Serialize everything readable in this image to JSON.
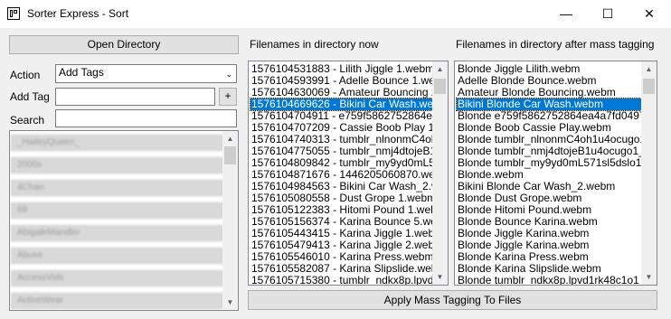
{
  "window": {
    "title": "Sorter Express - Sort",
    "minimize": "—",
    "maximize": "☐",
    "close": "✕"
  },
  "left": {
    "open_directory": "Open Directory",
    "action_label": "Action",
    "action_value": "Add Tags",
    "add_tag_label": "Add Tag",
    "add_tag_value": "",
    "add_button": "+",
    "search_label": "Search",
    "search_value": "",
    "tags": [
      "_HaileyQueen_",
      "2000s",
      "4Chan",
      "69",
      "AbigaleMandler",
      "Abuse",
      "AccessVids",
      "ActiveWear"
    ],
    "tag_scroll_thumb": 0.1
  },
  "middle": {
    "header": "Filenames in directory now",
    "files": [
      "1576104531883 - Lilith Jiggle 1.webm",
      "1576104593991 - Adelle Bounce 1.webm",
      "1576104630069 - Amateur Bouncing 2.webm",
      "1576104669626 - Bikini Car Wash.webm",
      "1576104704911 - e759f5862752864ea4a7",
      "1576104707209 - Cassie Boob Play 1.web",
      "1576104740313 - tumblr_nlnonmC4oh1u4c",
      "1576104775055 - tumblr_nmj4dtojeB1u4c",
      "1576104809842 - tumblr_my9yd0mL571sl",
      "1576104871676 - 1446205060870.webm",
      "1576104984563 - Bikini Car Wash_2.webm",
      "1576105080558 - Dust Grope 1.webm",
      "1576105122383 - Hitomi Pound 1.webm",
      "1576105156374 - Karina Bounce 5.webm",
      "1576105443415 - Karina Jiggle 1.webm",
      "1576105479413 - Karina Jiggle 2.webm",
      "1576105546010 - Karina Press.webm",
      "1576105582087 - Karina Slipslide.webm",
      "1576105715380 - tumblr_ndkx8p.lpvd1rk4"
    ],
    "selected_index": 3,
    "scroll_thumb": 0.08
  },
  "right": {
    "header": "Filenames in directory after mass tagging",
    "files": [
      "Blonde Jiggle Lilith.webm",
      "Adelle Blonde Bounce.webm",
      "Amateur Blonde Bouncing.webm",
      "Bikini Blonde Car Wash.webm",
      "Blonde e759f5862752864ea4a7fd0497f405",
      "Blonde Boob Cassie Play.webm",
      "Blonde tumblr_nlnonmC4oh1u4ocugo1_40",
      "Blonde tumblr_nmj4dtojeB1u4ocugo1_400",
      "Blonde tumblr_my9yd0mL571sl5dslo1_400",
      "Blonde.webm",
      "Bikini Blonde Car Wash_2.webm",
      "Blonde Dust Grope.webm",
      "Blonde Hitomi Pound.webm",
      "Blonde Bounce Karina.webm",
      "Blonde Jiggle Karina.webm",
      "Blonde Jiggle Karina.webm",
      "Blonde Karina Press.webm",
      "Blonde Karina Slipslide.webm",
      "Blonde tumblr_ndkx8p.lpvd1rk48c1o1_500"
    ],
    "selected_index": 3,
    "scroll_thumb": 0.08
  },
  "apply_button": "Apply Mass Tagging To Files"
}
